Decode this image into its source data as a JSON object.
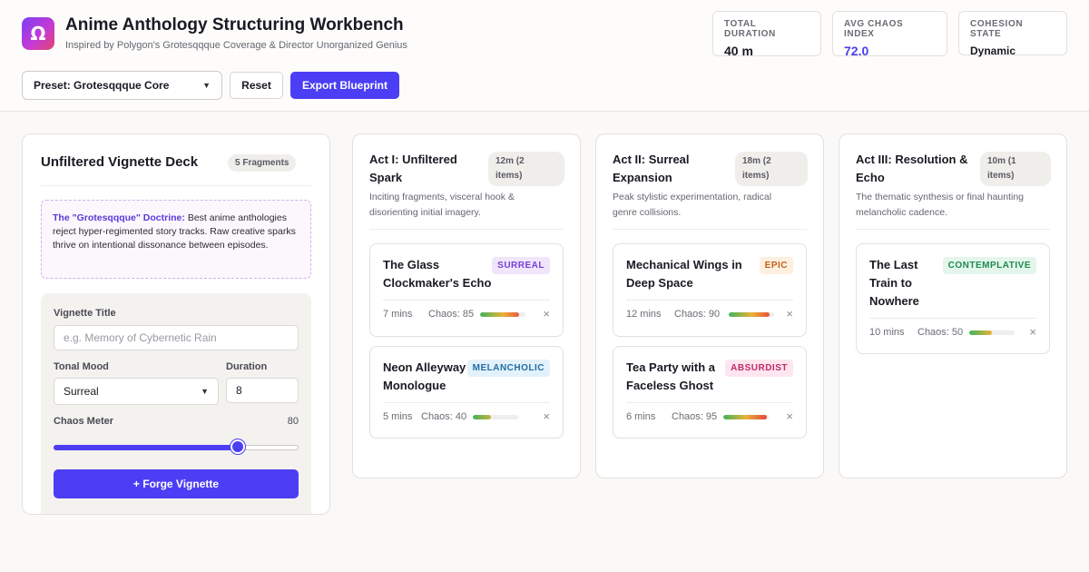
{
  "app": {
    "logo_glyph": "Ω",
    "title": "Anime Anthology Structuring Workbench",
    "subtitle": "Inspired by Polygon's Grotesqqque Coverage & Director Unorganized Genius"
  },
  "stats": [
    {
      "label": "Total Duration",
      "value": "40 m"
    },
    {
      "label": "Avg Chaos Index",
      "value": "72.0"
    },
    {
      "label": "Cohesion State",
      "value": "Dynamic"
    }
  ],
  "toolbar": {
    "preset_value": "Preset: Grotesqqque Core",
    "reset_label": "Reset",
    "export_label": "Export Blueprint"
  },
  "deck": {
    "title": "Unfiltered Vignette Deck",
    "count": "5 Fragments",
    "doctrine_strong": "The \"Grotesqqque\" Doctrine:",
    "doctrine_text": "Best anime anthologies reject hyper-regimented story tracks. Raw creative sparks thrive on intentional dissonance between episodes.",
    "form": {
      "title_label": "Vignette Title",
      "title_placeholder": "e.g. Memory of Cybernetic Rain",
      "mood_label": "Tonal Mood",
      "mood_value": "Surreal",
      "duration_label": "Duration",
      "duration_value": "8",
      "chaos_label": "Chaos Meter",
      "chaos_value": "80",
      "chaos_fraction": 0.75,
      "forge_label": "+ Forge Vignette"
    }
  },
  "acts": [
    {
      "title_line1": "Act I: Unfiltered",
      "title_line2": "Spark",
      "badge_line1": "12m (2",
      "badge_line2": "items)",
      "desc_line1": "Inciting fragments, visceral hook &",
      "desc_line2": "disorienting initial imagery.",
      "cards": [
        {
          "title_line1": "The Glass",
          "title_line2": "Clockmaker's Echo",
          "title_line3": "",
          "tag": "SURREAL",
          "duration": "7 mins",
          "chaos_text": "Chaos: 85",
          "chaos": 85
        },
        {
          "title_line1": "Neon Alleyway",
          "title_line2": "Monologue",
          "title_line3": "",
          "tag": "MELANCHOLIC",
          "duration": "5 mins",
          "chaos_text": "Chaos: 40",
          "chaos": 40
        }
      ]
    },
    {
      "title_line1": "Act II: Surreal",
      "title_line2": "Expansion",
      "badge_line1": "18m (2",
      "badge_line2": "items)",
      "desc_line1": "Peak stylistic experimentation, radical",
      "desc_line2": "genre collisions.",
      "cards": [
        {
          "title_line1": "Mechanical Wings in",
          "title_line2": "Deep Space",
          "title_line3": "",
          "tag": "EPIC",
          "duration": "12 mins",
          "chaos_text": "Chaos: 90",
          "chaos": 90
        },
        {
          "title_line1": "Tea Party with a",
          "title_line2": "Faceless Ghost",
          "title_line3": "",
          "tag": "ABSURDIST",
          "duration": "6 mins",
          "chaos_text": "Chaos: 95",
          "chaos": 95
        }
      ]
    },
    {
      "title_line1": "Act III: Resolution &",
      "title_line2": "Echo",
      "badge_line1": "10m (1",
      "badge_line2": "items)",
      "desc_line1": "The thematic synthesis or final haunting",
      "desc_line2": "melancholic cadence.",
      "cards": [
        {
          "title_line1": "The Last",
          "title_line2": "Train to",
          "title_line3": "Nowhere",
          "tag": "CONTEMPLATIVE",
          "duration": "10 mins",
          "chaos_text": "Chaos: 50",
          "chaos": 50
        }
      ]
    }
  ],
  "colors": {
    "accent": "#4c3ef4",
    "tag_surreal_bg": "#efe6fb",
    "tag_surreal_fg": "#7a3fd6",
    "tag_melancholic_bg": "#e3f1fb",
    "tag_melancholic_fg": "#1f6fa3",
    "tag_epic_bg": "#fdf0e1",
    "tag_epic_fg": "#c2601a",
    "tag_absurdist_bg": "#fde6ef",
    "tag_absurdist_fg": "#c02a6a",
    "tag_contemplative_bg": "#e4f6ec",
    "tag_contemplative_fg": "#1f8a4e"
  },
  "icons": {
    "close": "close-icon",
    "select_caret": "chevron-down-icon"
  }
}
